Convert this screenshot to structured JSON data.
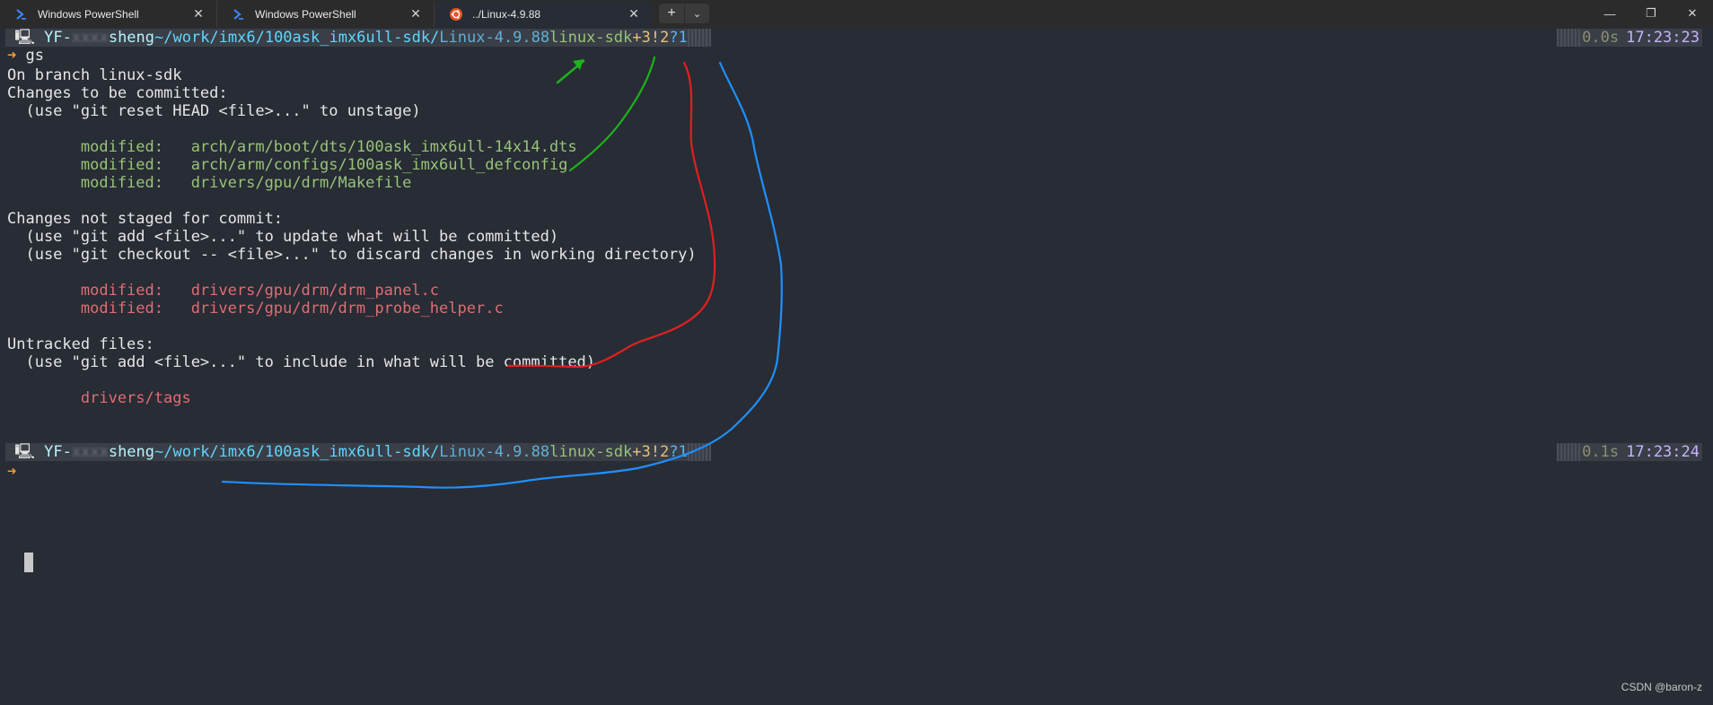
{
  "tabs": [
    {
      "title": "Windows PowerShell",
      "icon": "powershell-icon"
    },
    {
      "title": "Windows PowerShell",
      "icon": "powershell-icon"
    },
    {
      "title": "../Linux-4.9.88",
      "icon": "ubuntu-icon",
      "active": true
    }
  ],
  "tabbar": {
    "new_tab": "+",
    "dropdown": "⌄"
  },
  "window_controls": {
    "minimize": "—",
    "restore": "❐",
    "close": "✕"
  },
  "prompts": [
    {
      "os_glyph": "",
      "user": "YF-",
      "user_blurred": "xxxx",
      "user_tail": "sheng",
      "path_prefix": "~/work/imx6/100ask_imx6ull-sdk/",
      "path_last": "Linux-4.9.88",
      "branch": "linux-sdk",
      "staged": "+3",
      "modified": "!2",
      "untracked": "?1",
      "duration": "0.0s",
      "time": "17:23:23"
    },
    {
      "os_glyph": "",
      "user": "YF-",
      "user_blurred": "xxxx",
      "user_tail": "sheng",
      "path_prefix": "~/work/imx6/100ask_imx6ull-sdk/",
      "path_last": "Linux-4.9.88",
      "branch": "linux-sdk",
      "staged": "+3",
      "modified": "!2",
      "untracked": "?1",
      "duration": "0.1s",
      "time": "17:23:24"
    }
  ],
  "prompt_arrow": "➜",
  "command": "gs",
  "output": {
    "branch_line": "On branch linux-sdk",
    "staged_header": "Changes to be committed:",
    "staged_hint": "  (use \"git reset HEAD <file>...\" to unstage)",
    "staged_files": [
      "        modified:   arch/arm/boot/dts/100ask_imx6ull-14x14.dts",
      "        modified:   arch/arm/configs/100ask_imx6ull_defconfig",
      "        modified:   drivers/gpu/drm/Makefile"
    ],
    "unstaged_header": "Changes not staged for commit:",
    "unstaged_hint1": "  (use \"git add <file>...\" to update what will be committed)",
    "unstaged_hint2": "  (use \"git checkout -- <file>...\" to discard changes in working directory)",
    "unstaged_files": [
      "        modified:   drivers/gpu/drm/drm_panel.c",
      "        modified:   drivers/gpu/drm/drm_probe_helper.c"
    ],
    "untracked_header": "Untracked files:",
    "untracked_hint": "  (use \"git add <file>...\" to include in what will be committed)",
    "untracked_files": [
      "        drivers/tags"
    ]
  },
  "watermark": "CSDN @baron-z",
  "colors": {
    "background": "#282c34",
    "annotation_green": "#1db31d",
    "annotation_red": "#e02020",
    "annotation_blue": "#1e90ff"
  }
}
